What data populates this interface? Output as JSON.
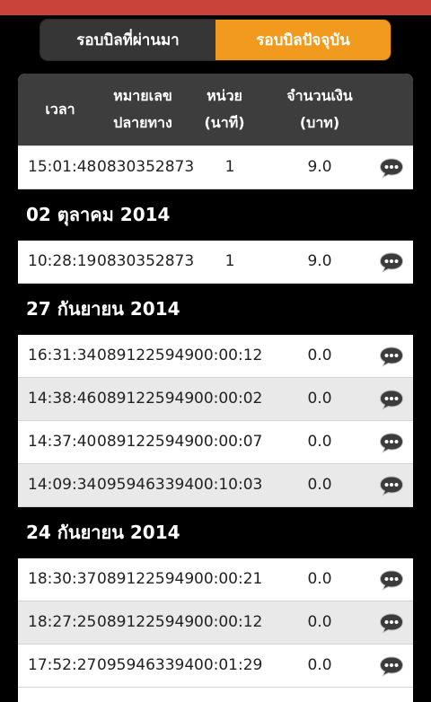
{
  "tabs": {
    "past": "รอบบิลที่ผ่านมา",
    "current": "รอบบิลปัจจุบัน"
  },
  "header": {
    "time": "เวลา",
    "dest_line1": "หมายเลข",
    "dest_line2": "ปลายทาง",
    "unit_line1": "หน่วย",
    "unit_line2": "(นาที)",
    "amount_line1": "จำนวนเงิน",
    "amount_line2": "(บาท)"
  },
  "rows": [
    {
      "time": "15:01:48",
      "number": "0830352873",
      "unit": "1",
      "amount": "9.0"
    },
    {
      "date": "02 ตุลาคม 2014"
    },
    {
      "time": "10:28:19",
      "number": "0830352873",
      "unit": "1",
      "amount": "9.0"
    },
    {
      "date": "27 กันยายน 2014"
    },
    {
      "time": "16:31:34",
      "number": "0891225949",
      "unit": "00:00:12",
      "amount": "0.0"
    },
    {
      "time": "14:38:46",
      "number": "0891225949",
      "unit": "00:00:02",
      "amount": "0.0"
    },
    {
      "time": "14:37:40",
      "number": "0891225949",
      "unit": "00:00:07",
      "amount": "0.0"
    },
    {
      "time": "14:09:34",
      "number": "0959463394",
      "unit": "00:10:03",
      "amount": "0.0"
    },
    {
      "date": "24 กันยายน 2014"
    },
    {
      "time": "18:30:37",
      "number": "0891225949",
      "unit": "00:00:21",
      "amount": "0.0"
    },
    {
      "time": "18:27:25",
      "number": "0891225949",
      "unit": "00:00:12",
      "amount": "0.0"
    },
    {
      "time": "17:52:27",
      "number": "0959463394",
      "unit": "00:01:29",
      "amount": "0.0"
    }
  ],
  "icons": {
    "row_action": "chat-bubble-icon"
  },
  "colors": {
    "accent": "#f29a1e",
    "top_strip": "#c8443a",
    "header_bg": "#3d3d3d"
  }
}
